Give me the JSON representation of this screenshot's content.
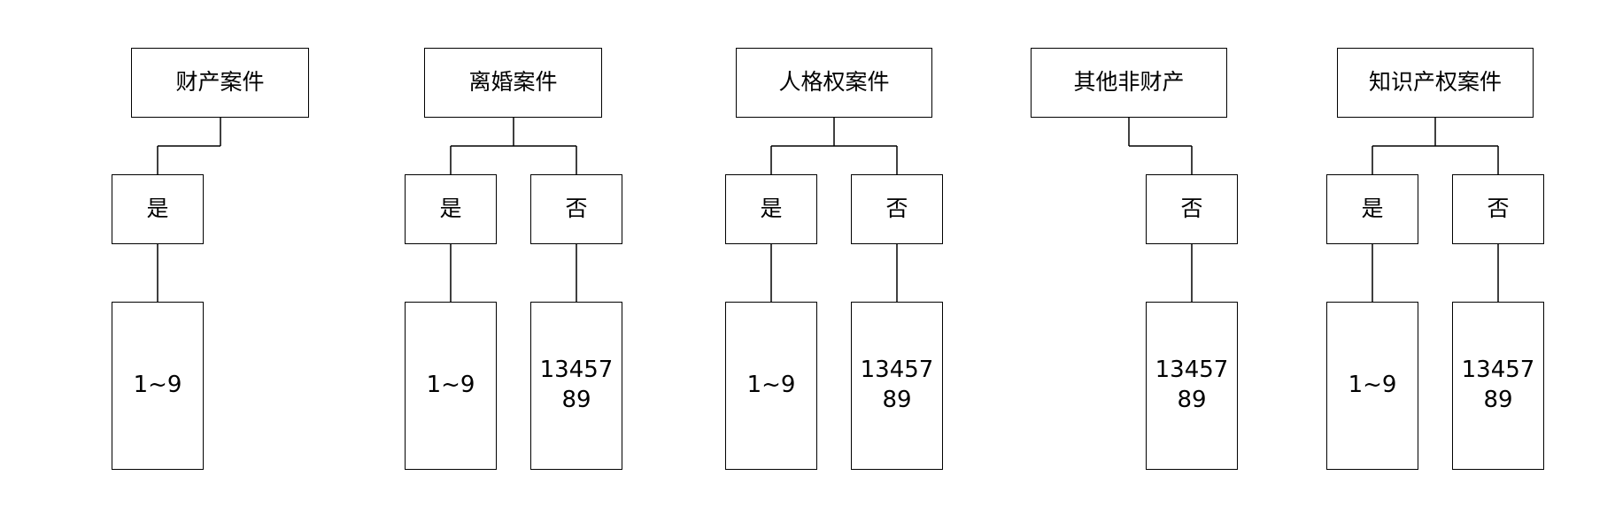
{
  "groups": [
    {
      "category": "财产案件",
      "branches": [
        {
          "answer": "是",
          "result": "1~9"
        }
      ]
    },
    {
      "category": "离婚案件",
      "branches": [
        {
          "answer": "是",
          "result": "1~9"
        },
        {
          "answer": "否",
          "result": "1345789"
        }
      ]
    },
    {
      "category": "人格权案件",
      "branches": [
        {
          "answer": "是",
          "result": "1~9"
        },
        {
          "answer": "否",
          "result": "1345789"
        }
      ]
    },
    {
      "category": "其他非财产",
      "branches": [
        {
          "answer": "否",
          "result": "1345789"
        }
      ]
    },
    {
      "category": "知识产权案件",
      "branches": [
        {
          "answer": "是",
          "result": "1~9"
        },
        {
          "answer": "否",
          "result": "1345789"
        }
      ]
    }
  ]
}
